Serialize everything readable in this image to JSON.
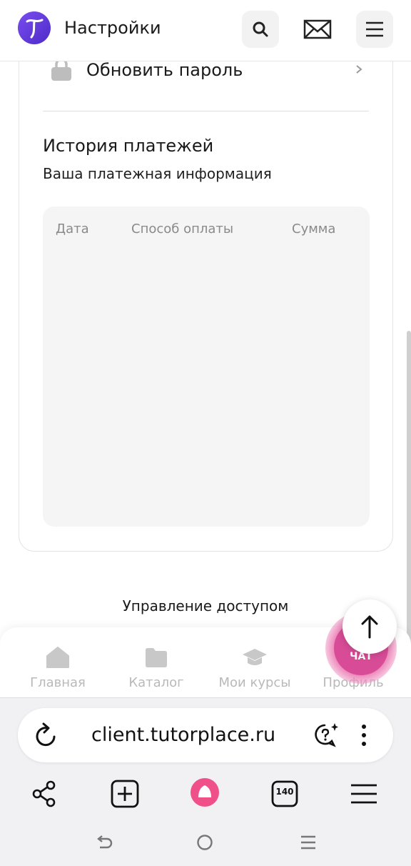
{
  "header": {
    "title": "Настройки",
    "logo_letter": "T",
    "logo_color": "#6b3fe0"
  },
  "settings": {
    "update_password_label": "Обновить пароль"
  },
  "payments": {
    "title": "История платежей",
    "subtitle": "Ваша платежная информация",
    "columns": [
      "Дата",
      "Способ оплаты",
      "Сумма"
    ],
    "rows": []
  },
  "access": {
    "label": "Управление доступом"
  },
  "bottom_nav": {
    "items": [
      {
        "label": "Главная",
        "icon": "home-icon"
      },
      {
        "label": "Каталог",
        "icon": "folder-icon"
      },
      {
        "label": "Мои курсы",
        "icon": "graduation-cap-icon"
      },
      {
        "label": "Профиль",
        "icon": "user-icon"
      }
    ]
  },
  "chat": {
    "label": "ЧАТ",
    "color": "#d84c97"
  },
  "browser": {
    "url": "client.tutorplace.ru",
    "tabs_count": "140",
    "alice_color": "#f0508a"
  }
}
